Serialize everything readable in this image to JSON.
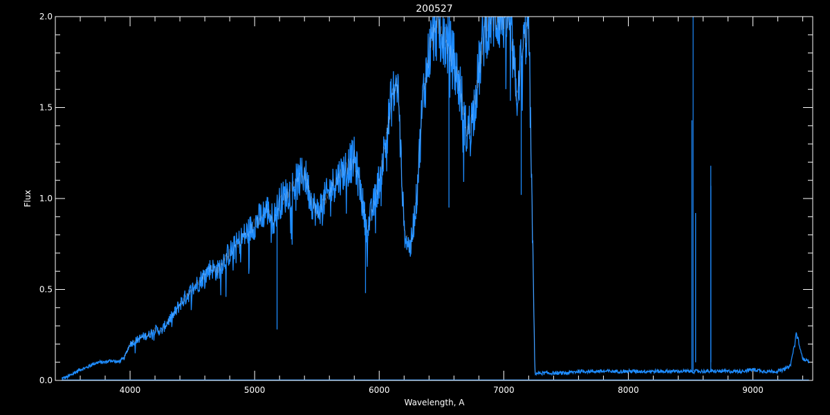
{
  "chart_data": {
    "type": "line",
    "title": "200527",
    "xlabel": "Wavelength, A",
    "ylabel": "Flux",
    "xlim": [
      3400,
      9480
    ],
    "ylim": [
      0.0,
      2.0
    ],
    "x_ticks": [
      4000,
      5000,
      6000,
      7000,
      8000,
      9000
    ],
    "x_tick_labels": [
      "4000",
      "5000",
      "6000",
      "7000",
      "8000",
      "9000"
    ],
    "y_ticks": [
      0.0,
      0.5,
      1.0,
      1.5,
      2.0
    ],
    "y_tick_labels": [
      "0.0",
      "0.5",
      "1.0",
      "1.5",
      "2.0"
    ],
    "grid": false,
    "colors": {
      "background": "#000000",
      "axes": "#ffffff",
      "series": "#1e8cff",
      "highlight": "#ffffff"
    },
    "series": [
      {
        "x": [
          3450,
          3500,
          3550,
          3600,
          3650,
          3700,
          3750,
          3800,
          3850,
          3900,
          3950,
          4000,
          4050,
          4100,
          4150,
          4200,
          4250,
          4300,
          4350,
          4400,
          4450,
          4500,
          4550,
          4600,
          4650,
          4700,
          4750,
          4800,
          4850,
          4900,
          4950,
          5000,
          5050,
          5100,
          5150,
          5200,
          5250,
          5300,
          5350,
          5400,
          5450,
          5500,
          5550,
          5600,
          5650,
          5700,
          5750,
          5800,
          5850,
          5900,
          5950,
          6000,
          6050,
          6100,
          6150,
          6200,
          6250,
          6300,
          6350,
          6400,
          6450,
          6500,
          6550,
          6600,
          6650,
          6700,
          6750,
          6800,
          6850,
          6900,
          6950,
          7000,
          7050,
          7100,
          7150,
          7200,
          7250,
          7300,
          7350,
          7400,
          7500,
          7600,
          7700,
          7800,
          7900,
          8000,
          8100,
          8200,
          8300,
          8400,
          8500,
          8550,
          8600,
          8700,
          8800,
          8900,
          9000,
          9100,
          9200,
          9250,
          9300,
          9350,
          9400,
          9450
        ],
        "y": [
          0.01,
          0.02,
          0.04,
          0.06,
          0.07,
          0.09,
          0.1,
          0.1,
          0.11,
          0.1,
          0.12,
          0.2,
          0.22,
          0.24,
          0.25,
          0.28,
          0.27,
          0.32,
          0.36,
          0.42,
          0.46,
          0.5,
          0.54,
          0.58,
          0.62,
          0.6,
          0.66,
          0.7,
          0.74,
          0.78,
          0.82,
          0.86,
          0.9,
          0.94,
          0.88,
          0.98,
          1.02,
          1.06,
          1.1,
          1.14,
          1.0,
          0.92,
          0.98,
          1.04,
          1.1,
          1.14,
          1.18,
          1.22,
          1.05,
          0.82,
          0.95,
          1.1,
          1.3,
          1.55,
          1.62,
          0.82,
          0.72,
          1.0,
          1.55,
          1.8,
          1.95,
          1.9,
          1.85,
          1.75,
          1.6,
          1.35,
          1.45,
          1.7,
          1.95,
          2.0,
          2.0,
          2.0,
          2.0,
          1.55,
          1.8,
          2.0,
          0.04,
          0.04,
          0.04,
          0.04,
          0.04,
          0.05,
          0.05,
          0.05,
          0.05,
          0.05,
          0.05,
          0.05,
          0.05,
          0.05,
          0.05,
          0.05,
          0.05,
          0.05,
          0.05,
          0.05,
          0.06,
          0.05,
          0.05,
          0.06,
          0.08,
          0.25,
          0.12,
          0.1
        ]
      }
    ],
    "dips": [
      {
        "x": 5180,
        "y": 0.28
      },
      {
        "x": 5890,
        "y": 0.48
      },
      {
        "x": 6250,
        "y": 0.68
      },
      {
        "x": 6560,
        "y": 0.95
      },
      {
        "x": 7140,
        "y": 1.02
      },
      {
        "x": 8540,
        "y": 0.92
      },
      {
        "x": 8662,
        "y": 1.07
      }
    ],
    "spikes": [
      {
        "x": 8510,
        "y": 1.43
      },
      {
        "x": 8520,
        "y": 2.0
      },
      {
        "x": 8662,
        "y": 1.18
      }
    ]
  }
}
